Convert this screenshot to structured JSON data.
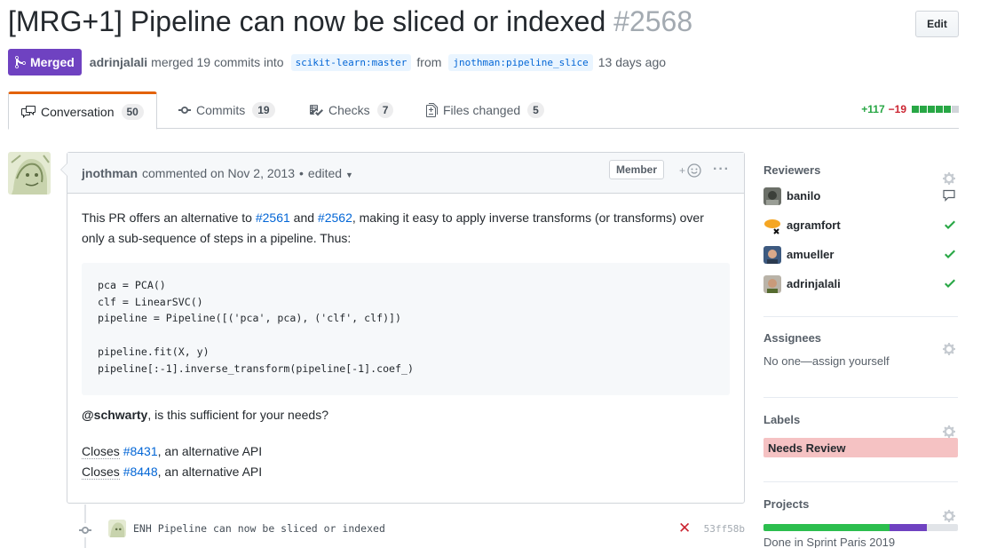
{
  "pr": {
    "title": "[MRG+1] Pipeline can now be sliced or indexed",
    "number": "#2568",
    "edit_label": "Edit",
    "state": "Merged",
    "author": "adrinjalali",
    "merged_text": "merged 19 commits into",
    "base_branch": "scikit-learn:master",
    "from_text": "from",
    "head_branch": "jnothman:pipeline_slice",
    "time_ago": "13 days ago"
  },
  "tabs": [
    {
      "label": "Conversation",
      "count": "50",
      "icon": "comment-discussion-icon"
    },
    {
      "label": "Commits",
      "count": "19",
      "icon": "git-commit-icon"
    },
    {
      "label": "Checks",
      "count": "7",
      "icon": "checklist-icon"
    },
    {
      "label": "Files changed",
      "count": "5",
      "icon": "file-diff-icon"
    }
  ],
  "diffstat": {
    "additions": "+117",
    "deletions": "−19",
    "blocks": [
      "#28a745",
      "#28a745",
      "#28a745",
      "#28a745",
      "#28a745",
      "#d1d5da"
    ]
  },
  "comment": {
    "author": "jnothman",
    "commented_text": "commented on Nov 2, 2013",
    "separator": "•",
    "edited": "edited",
    "role": "Member",
    "intro_1": "This PR offers an alternative to ",
    "link_1": "#2561",
    "intro_and": " and ",
    "link_2": "#2562",
    "intro_2": ", making it easy to apply inverse transforms (or transforms) over only a sub-sequence of steps in a pipeline. Thus:",
    "code": "pca = PCA()\nclf = LinearSVC()\npipeline = Pipeline([('pca', pca), ('clf', clf)])\n\npipeline.fit(X, y)\npipeline[:-1].inverse_transform(pipeline[-1].coef_)",
    "mention": "@schwarty",
    "mention_rest": ", is this sufficient for your needs?",
    "closes": [
      {
        "word": "Closes",
        "link": "#8431",
        "rest": ", an alternative API"
      },
      {
        "word": "Closes",
        "link": "#8448",
        "rest": ", an alternative API"
      }
    ]
  },
  "commit": {
    "message": "ENH Pipeline can now be sliced or indexed",
    "status": "failure",
    "sha": "53ff58b"
  },
  "sidebar": {
    "reviewers_title": "Reviewers",
    "reviewers": [
      {
        "name": "banilo",
        "status": "comment-icon"
      },
      {
        "name": "agramfort",
        "status": "check-icon"
      },
      {
        "name": "amueller",
        "status": "check-icon"
      },
      {
        "name": "adrinjalali",
        "status": "check-icon"
      }
    ],
    "assignees_title": "Assignees",
    "assignees_text": "No one—assign yourself",
    "labels_title": "Labels",
    "label": "Needs Review",
    "label_color": "#f5c2c3",
    "projects_title": "Projects",
    "project_status": "Done in Sprint Paris 2019",
    "project_progress": {
      "done": 0.65,
      "in_progress": 0.19
    }
  }
}
